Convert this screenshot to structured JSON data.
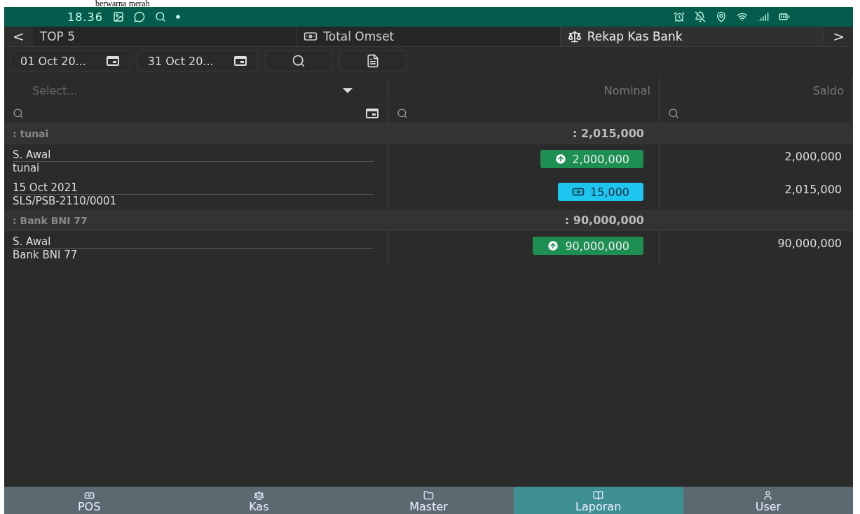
{
  "caption": "berwarna merah",
  "status_bar": {
    "time": "18.36"
  },
  "tabs": {
    "prev": "<",
    "next": ">",
    "items": [
      {
        "label": "TOP 5",
        "kind": "plain",
        "selected": false
      },
      {
        "label": "Total Omset",
        "kind": "money",
        "selected": false
      },
      {
        "label": "Rekap Kas Bank",
        "kind": "scale",
        "selected": true
      }
    ]
  },
  "filters": {
    "date_from": "01 Oct 20...",
    "date_to": "31 Oct 20..."
  },
  "table": {
    "columns": [
      {
        "kind": "select",
        "placeholder": "Select..."
      },
      {
        "kind": "text",
        "label": "Nominal"
      },
      {
        "kind": "text",
        "label": "Saldo"
      }
    ],
    "groups": [
      {
        "label": ": tunai",
        "total": ": 2,015,000",
        "rows": [
          {
            "line_1": "S. Awal",
            "line_2": "tunai",
            "kind": "opening",
            "amount": "2,000,000",
            "saldo": "2,000,000"
          },
          {
            "line_1": "15 Oct 2021",
            "line_2": "SLS/PSB-2110/0001",
            "kind": "sale",
            "amount": "15,000",
            "saldo": "2,015,000"
          }
        ]
      },
      {
        "label": ": Bank BNI 77",
        "total": ": 90,000,000",
        "rows": [
          {
            "line_1": "S. Awal",
            "line_2": "Bank BNI 77",
            "kind": "opening",
            "amount": "90,000,000",
            "saldo": "90,000,000"
          }
        ]
      }
    ]
  },
  "bottom_nav": [
    {
      "label": "POS",
      "kind": "money",
      "selected": false
    },
    {
      "label": "Kas",
      "kind": "scale",
      "selected": false
    },
    {
      "label": "Master",
      "kind": "folder",
      "selected": false
    },
    {
      "label": "Laporan",
      "kind": "book",
      "selected": true
    },
    {
      "label": "User",
      "kind": "user",
      "selected": false
    }
  ]
}
